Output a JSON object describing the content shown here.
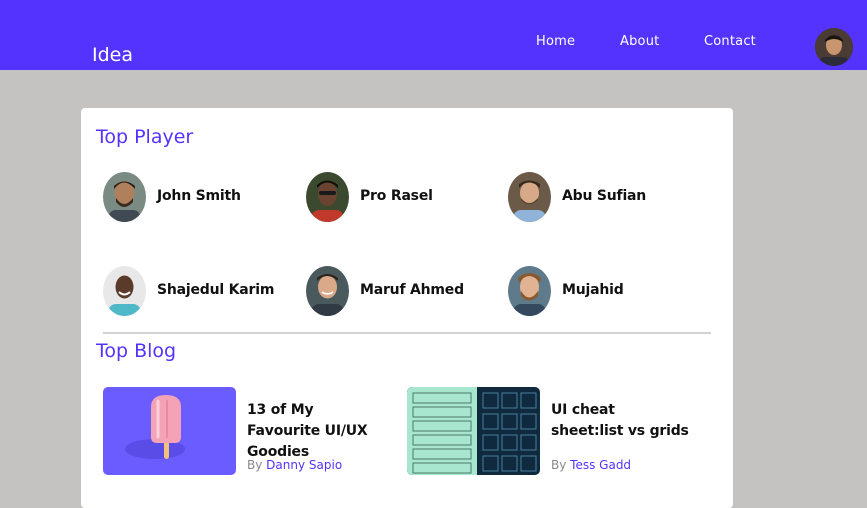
{
  "nav": {
    "brand": "Idea",
    "links": [
      {
        "label": "Home"
      },
      {
        "label": "About"
      },
      {
        "label": "Contact"
      }
    ]
  },
  "top_player": {
    "title": "Top Player",
    "players": [
      {
        "name": "John Smith",
        "avatar": "person-photo"
      },
      {
        "name": "Pro Rasel",
        "avatar": "person-photo"
      },
      {
        "name": "Abu Sufian",
        "avatar": "person-photo"
      },
      {
        "name": "Shajedul Karim",
        "avatar": "person-photo"
      },
      {
        "name": "Maruf Ahmed",
        "avatar": "person-photo"
      },
      {
        "name": "Mujahid",
        "avatar": "person-photo"
      }
    ]
  },
  "top_blog": {
    "title": "Top Blog",
    "posts": [
      {
        "title": "13 of My Favourite UI/UX Goodies",
        "by": "By",
        "author": "Danny Sapio",
        "image": "popsicle-illustration"
      },
      {
        "title": "UI cheat sheet:list vs grids",
        "by": "By",
        "author": "Tess Gadd",
        "image": "list-vs-grid-illustration"
      }
    ]
  },
  "colors": {
    "accent": "#5533ff",
    "page_background": "#c4c3c2",
    "card_background": "#ffffff"
  }
}
